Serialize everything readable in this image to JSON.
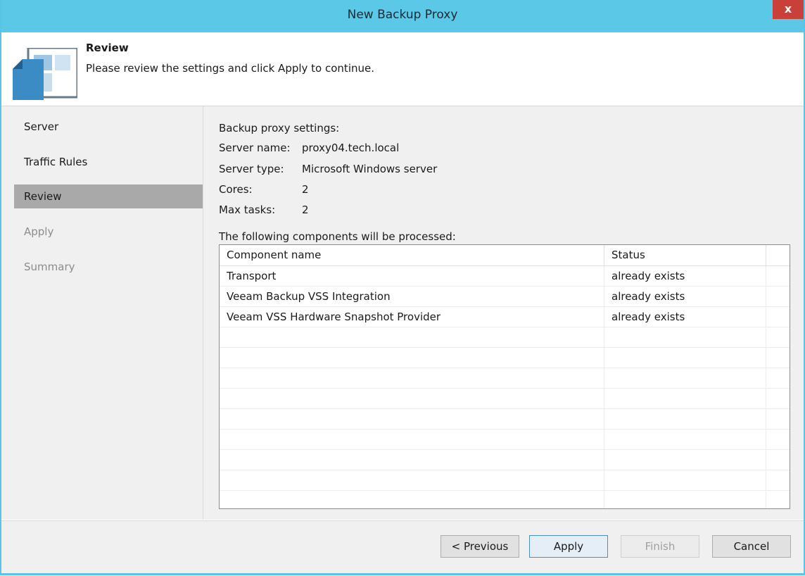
{
  "window": {
    "title": "New Backup Proxy",
    "close_glyph": "x",
    "accent_color": "#5bc8e8",
    "close_color": "#c9403b"
  },
  "header": {
    "title": "Review",
    "description": "Please review the settings and click Apply to continue.",
    "icon": "backup-proxy-icon"
  },
  "steps": [
    {
      "label": "Server",
      "state": "done"
    },
    {
      "label": "Traffic Rules",
      "state": "done"
    },
    {
      "label": "Review",
      "state": "active"
    },
    {
      "label": "Apply",
      "state": "disabled"
    },
    {
      "label": "Summary",
      "state": "disabled"
    }
  ],
  "settings": {
    "heading": "Backup proxy settings:",
    "server_name_label": "Server name:",
    "server_name_value": "proxy04.tech.local",
    "server_type_label": "Server type:",
    "server_type_value": "Microsoft Windows server",
    "cores_label": "Cores:",
    "cores_value": "2",
    "max_tasks_label": "Max tasks:",
    "max_tasks_value": "2"
  },
  "components": {
    "heading": "The following components will be processed:",
    "columns": [
      "Component name",
      "Status"
    ],
    "rows": [
      {
        "name": "Transport",
        "status": "already exists"
      },
      {
        "name": "Veeam Backup VSS Integration",
        "status": "already exists"
      },
      {
        "name": "Veeam VSS Hardware Snapshot Provider",
        "status": "already exists"
      }
    ]
  },
  "buttons": {
    "previous": "< Previous",
    "apply": "Apply",
    "finish": "Finish",
    "cancel": "Cancel"
  }
}
